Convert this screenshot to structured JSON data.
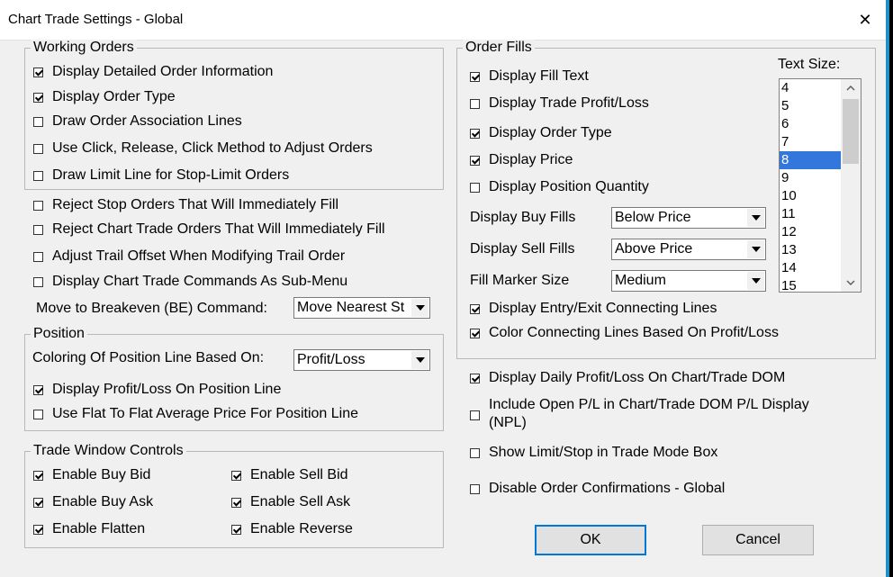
{
  "window": {
    "title": "Chart Trade Settings - Global",
    "close_glyph": "✕"
  },
  "working_orders": {
    "title": "Working Orders",
    "items": [
      {
        "label": "Display Detailed Order Information",
        "checked": true
      },
      {
        "label": "Display Order Type",
        "checked": true
      },
      {
        "label": "Draw Order Association Lines",
        "checked": false
      },
      {
        "label": "Use Click, Release, Click Method to Adjust Orders",
        "checked": false
      },
      {
        "label": "Draw Limit Line for Stop-Limit Orders",
        "checked": false
      }
    ]
  },
  "misc": {
    "items": [
      {
        "label": "Reject Stop Orders That Will Immediately Fill",
        "checked": false
      },
      {
        "label": "Reject Chart Trade Orders That Will Immediately Fill",
        "checked": false
      },
      {
        "label": "Adjust Trail Offset When Modifying Trail Order",
        "checked": false
      },
      {
        "label": "Display Chart Trade Commands As Sub-Menu",
        "checked": false
      }
    ],
    "breakeven_label": "Move to Breakeven (BE) Command:",
    "breakeven_value": "Move Nearest St"
  },
  "position": {
    "title": "Position",
    "coloring_label": "Coloring Of Position Line Based On:",
    "coloring_value": "Profit/Loss",
    "items": [
      {
        "label": "Display Profit/Loss On Position Line",
        "checked": true
      },
      {
        "label": "Use Flat To Flat Average Price For Position Line",
        "checked": false
      }
    ]
  },
  "trade_window": {
    "title": "Trade Window Controls",
    "items": [
      {
        "label": "Enable Buy Bid",
        "checked": true
      },
      {
        "label": "Enable Buy Ask",
        "checked": true
      },
      {
        "label": "Enable Flatten",
        "checked": true
      },
      {
        "label": "Enable Sell Bid",
        "checked": true
      },
      {
        "label": "Enable Sell Ask",
        "checked": true
      },
      {
        "label": "Enable Reverse",
        "checked": true
      }
    ]
  },
  "order_fills": {
    "title": "Order Fills",
    "items": [
      {
        "label": "Display Fill Text",
        "checked": true
      },
      {
        "label": "Display Trade Profit/Loss",
        "checked": false
      },
      {
        "label": "Display Order Type",
        "checked": true
      },
      {
        "label": "Display Price",
        "checked": true
      },
      {
        "label": "Display Position Quantity",
        "checked": false
      }
    ],
    "buy_fills_label": "Display Buy Fills",
    "buy_fills_value": "Below Price",
    "sell_fills_label": "Display Sell Fills",
    "sell_fills_value": "Above Price",
    "marker_size_label": "Fill Marker Size",
    "marker_size_value": "Medium",
    "bottom_items": [
      {
        "label": "Display Entry/Exit Connecting Lines",
        "checked": true
      },
      {
        "label": "Color Connecting Lines Based On Profit/Loss",
        "checked": true
      }
    ],
    "text_size_label": "Text Size:",
    "text_sizes": [
      "4",
      "5",
      "6",
      "7",
      "8",
      "9",
      "10",
      "11",
      "12",
      "13",
      "14",
      "15"
    ],
    "text_size_selected": "8"
  },
  "global_options": {
    "items": [
      {
        "label": "Display Daily Profit/Loss On Chart/Trade DOM",
        "checked": true
      },
      {
        "label": "Include Open P/L in Chart/Trade DOM P/L Display",
        "label2": "(NPL)",
        "checked": false
      },
      {
        "label": "Show Limit/Stop in Trade Mode Box",
        "checked": false
      },
      {
        "label": "Disable Order Confirmations - Global",
        "checked": false
      }
    ]
  },
  "buttons": {
    "ok": "OK",
    "cancel": "Cancel"
  },
  "colors": {
    "accent": "#0078d7",
    "selection": "#3377dd",
    "frame": "#1e90c8"
  }
}
